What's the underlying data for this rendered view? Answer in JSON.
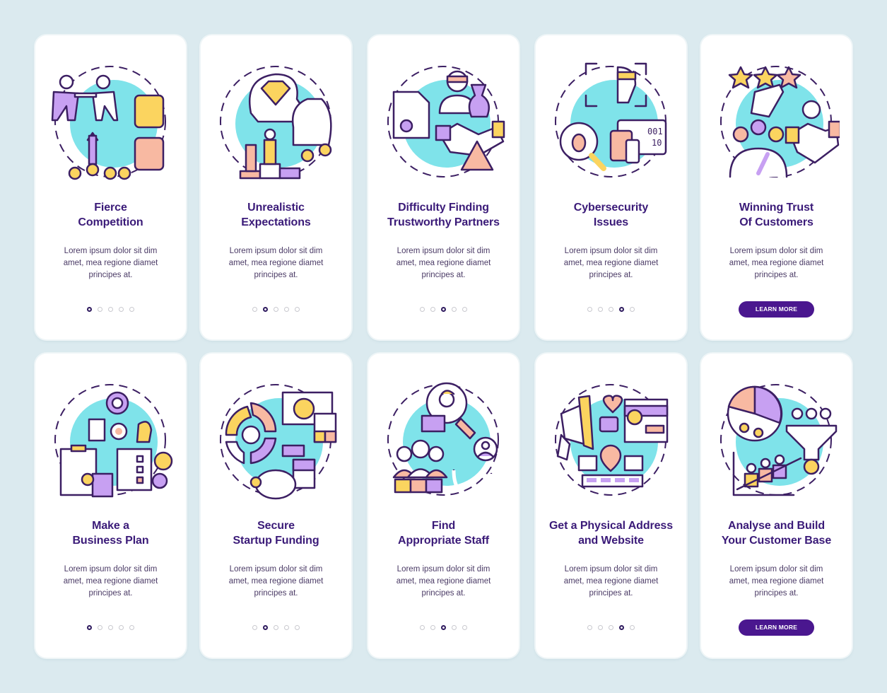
{
  "theme": {
    "background": "#dbeaef",
    "card": "#ffffff",
    "title_color": "#3a1a78",
    "text_color": "#4b3b66",
    "accent_button": "#4a178f",
    "illustration_circle": "#7fe3ea",
    "outline": "#3c1f63",
    "purple": "#c7a0f2",
    "yellow": "#fbd45f",
    "pink": "#f8b9a2"
  },
  "cards": [
    {
      "title": "Fierce\nCompetition",
      "description": "Lorem ipsum dolor sit dim amet, mea regione diamet principes at.",
      "icon": "tug-of-war-competition-icon",
      "active_dot": 0,
      "button": null
    },
    {
      "title": "Unrealistic\nExpectations",
      "description": "Lorem ipsum dolor sit dim amet, mea regione diamet principes at.",
      "icon": "diamond-head-money-bag-icon",
      "active_dot": 1,
      "button": null
    },
    {
      "title": "Difficulty Finding\nTrustworthy Partners",
      "description": "Lorem ipsum dolor sit dim amet, mea regione diamet principes at.",
      "icon": "thief-handshake-warning-icon",
      "active_dot": 2,
      "button": null
    },
    {
      "title": "Cybersecurity\nIssues",
      "description": "Lorem ipsum dolor sit dim amet, mea regione diamet principes at.",
      "icon": "hacker-bug-devices-icon",
      "active_dot": 3,
      "button": null
    },
    {
      "title": "Winning Trust\nOf Customers",
      "description": "Lorem ipsum dolor sit dim amet, mea regione diamet principes at.",
      "icon": "rating-handshake-gauge-icon",
      "active_dot": null,
      "button": "LEARN MORE"
    },
    {
      "title": "Make a\nBusiness Plan",
      "description": "Lorem ipsum dolor sit dim amet, mea regione diamet principes at.",
      "icon": "business-plan-gears-icon",
      "active_dot": 0,
      "button": null
    },
    {
      "title": "Secure\nStartup Funding",
      "description": "Lorem ipsum dolor sit dim amet, mea regione diamet principes at.",
      "icon": "funding-piggy-bank-icon",
      "active_dot": 1,
      "button": null
    },
    {
      "title": "Find\nAppropriate Staff",
      "description": "Lorem ipsum dolor sit dim amet, mea regione diamet principes at.",
      "icon": "staff-search-magnet-icon",
      "active_dot": 2,
      "button": null
    },
    {
      "title": "Get a Physical Address\nand Website",
      "description": "Lorem ipsum dolor sit dim amet, mea regione diamet principes at.",
      "icon": "megaphone-location-website-icon",
      "active_dot": 3,
      "button": null
    },
    {
      "title": "Analyse and Build\nYour Customer Base",
      "description": "Lorem ipsum dolor sit dim amet, mea regione diamet principes at.",
      "icon": "customer-pie-funnel-growth-icon",
      "active_dot": null,
      "button": "LEARN MORE"
    }
  ],
  "pagination_total": 5
}
